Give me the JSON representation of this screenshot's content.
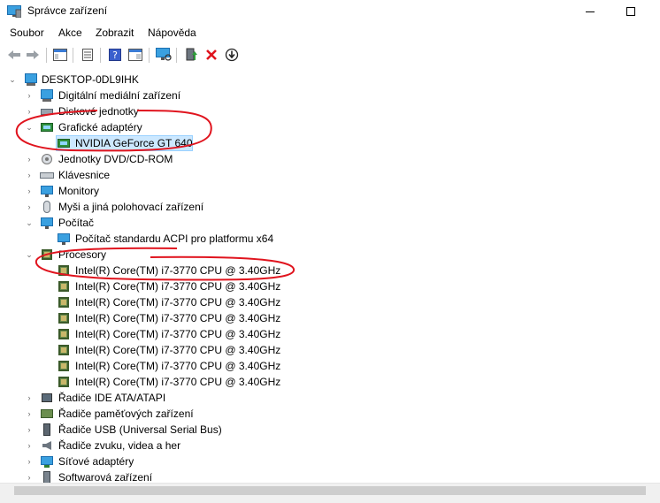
{
  "window": {
    "title": "Správce zařízení"
  },
  "menu": [
    "Soubor",
    "Akce",
    "Zobrazit",
    "Nápověda"
  ],
  "toolbar": {
    "icons": [
      "back-arrow-icon",
      "forward-arrow-icon",
      "show-hide-console-tree-icon",
      "properties-icon",
      "help-icon",
      "view-icon",
      "scan-hardware-icon",
      "update-driver-icon",
      "uninstall-device-icon",
      "disable-device-icon"
    ]
  },
  "tree": {
    "root": "DESKTOP-0DL9IHK",
    "items": [
      {
        "label": "Digitální mediální zařízení",
        "expanded": false
      },
      {
        "label": "Diskové jednotky",
        "expanded": false
      },
      {
        "label": "Grafické adaptéry",
        "expanded": true
      },
      {
        "label": "NVIDIA GeForce GT 640",
        "child": true,
        "selected": true
      },
      {
        "label": "Jednotky DVD/CD-ROM",
        "expanded": false
      },
      {
        "label": "Klávesnice",
        "expanded": false
      },
      {
        "label": "Monitory",
        "expanded": false
      },
      {
        "label": "Myši a jiná polohovací zařízení",
        "expanded": false
      },
      {
        "label": "Počítač",
        "expanded": true
      },
      {
        "label": "Počítač standardu ACPI pro platformu x64",
        "child": true
      },
      {
        "label": "Procesory",
        "expanded": true
      },
      {
        "label": "Intel(R) Core(TM) i7-3770 CPU @ 3.40GHz",
        "child": true
      },
      {
        "label": "Intel(R) Core(TM) i7-3770 CPU @ 3.40GHz",
        "child": true
      },
      {
        "label": "Intel(R) Core(TM) i7-3770 CPU @ 3.40GHz",
        "child": true
      },
      {
        "label": "Intel(R) Core(TM) i7-3770 CPU @ 3.40GHz",
        "child": true
      },
      {
        "label": "Intel(R) Core(TM) i7-3770 CPU @ 3.40GHz",
        "child": true
      },
      {
        "label": "Intel(R) Core(TM) i7-3770 CPU @ 3.40GHz",
        "child": true
      },
      {
        "label": "Intel(R) Core(TM) i7-3770 CPU @ 3.40GHz",
        "child": true
      },
      {
        "label": "Intel(R) Core(TM) i7-3770 CPU @ 3.40GHz",
        "child": true
      },
      {
        "label": "Řadiče IDE ATA/ATAPI",
        "expanded": false
      },
      {
        "label": "Řadiče paměťových zařízení",
        "expanded": false
      },
      {
        "label": "Řadiče USB (Universal Serial Bus)",
        "expanded": false
      },
      {
        "label": "Řadiče zvuku, videa a her",
        "expanded": false
      },
      {
        "label": "Síťové adaptéry",
        "expanded": false
      },
      {
        "label": "Softwarová zařízení",
        "expanded": false
      }
    ]
  },
  "colors": {
    "selection": "#cce8ff",
    "annotation": "#e0141e"
  }
}
